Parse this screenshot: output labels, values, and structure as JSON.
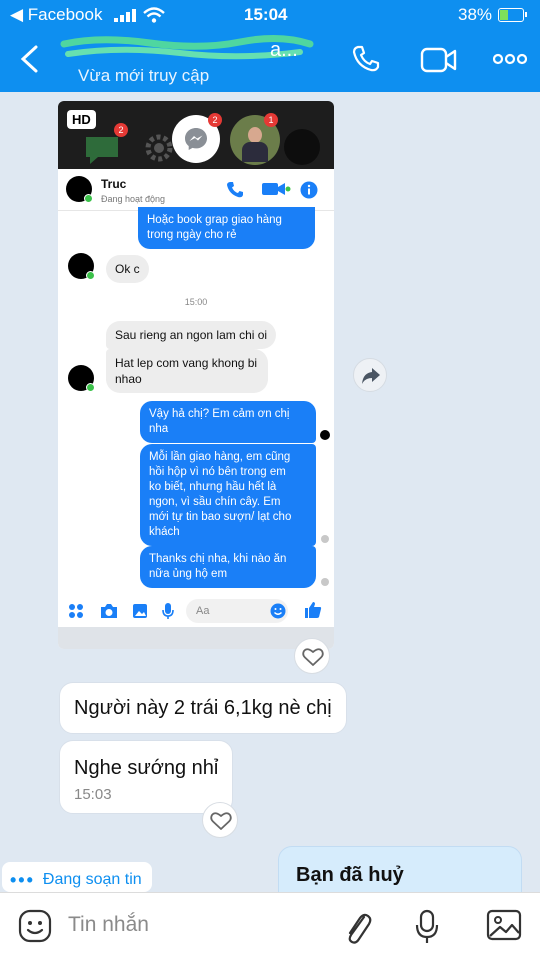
{
  "status_bar": {
    "back_app": "◀ Facebook",
    "time": "15:04",
    "battery": "38%",
    "battery_level": 0.38
  },
  "header": {
    "contact_status": "Vừa mới truy cập"
  },
  "screenshot": {
    "hd_badge": "HD",
    "messenger_badge": "2",
    "photo_badge": "1",
    "contact_name": "Truc",
    "contact_status": "Đang hoạt động",
    "messages": [
      {
        "id": "m1",
        "text": "Hoặc book grap giao hàng\ntrong ngày cho rẻ"
      },
      {
        "id": "m2",
        "text": "Ok c"
      },
      {
        "id": "t1",
        "text": "15:00"
      },
      {
        "id": "m3",
        "text": "Sau rieng an ngon lam chi oi"
      },
      {
        "id": "m4",
        "text": "Hat lep com vang khong bi\nnhao"
      },
      {
        "id": "m5",
        "text": "Vậy hả chị? Em cảm ơn chị\nnha"
      },
      {
        "id": "m6",
        "text": "Mỗi lần giao hàng, em cũng\nhồi hộp vì nó bên trong em\nko biết, nhưng hầu hết là\nngon, vì sầu chín cây. Em\nmới tự tin bao sượn/ lạt cho\nkhách"
      },
      {
        "id": "m7",
        "text": "Thanks chị nha, khi nào ăn\nnữa ủng hộ em"
      }
    ],
    "composer_placeholder": "Aa"
  },
  "messages": [
    {
      "id": "b1",
      "text": "Người này 2 trái 6,1kg nè chị"
    },
    {
      "id": "b2",
      "text": "Nghe sướng nhỉ",
      "time": "15:03"
    }
  ],
  "typing_indicator": {
    "dots": "•••",
    "label": "Đang soạn tin"
  },
  "outgoing_preview": "Bạn đã huỷ",
  "input": {
    "placeholder": "Tin nhắn"
  },
  "colors": {
    "header": "#0e8ff0",
    "messenger_blue": "#1a7ff7",
    "background": "#dfe8f2"
  },
  "icons": [
    "back-chevron-icon",
    "phone-icon",
    "video-call-icon",
    "more-icon",
    "forward-icon",
    "heart-icon",
    "emoji-icon",
    "attach-icon",
    "mic-icon",
    "image-icon"
  ]
}
